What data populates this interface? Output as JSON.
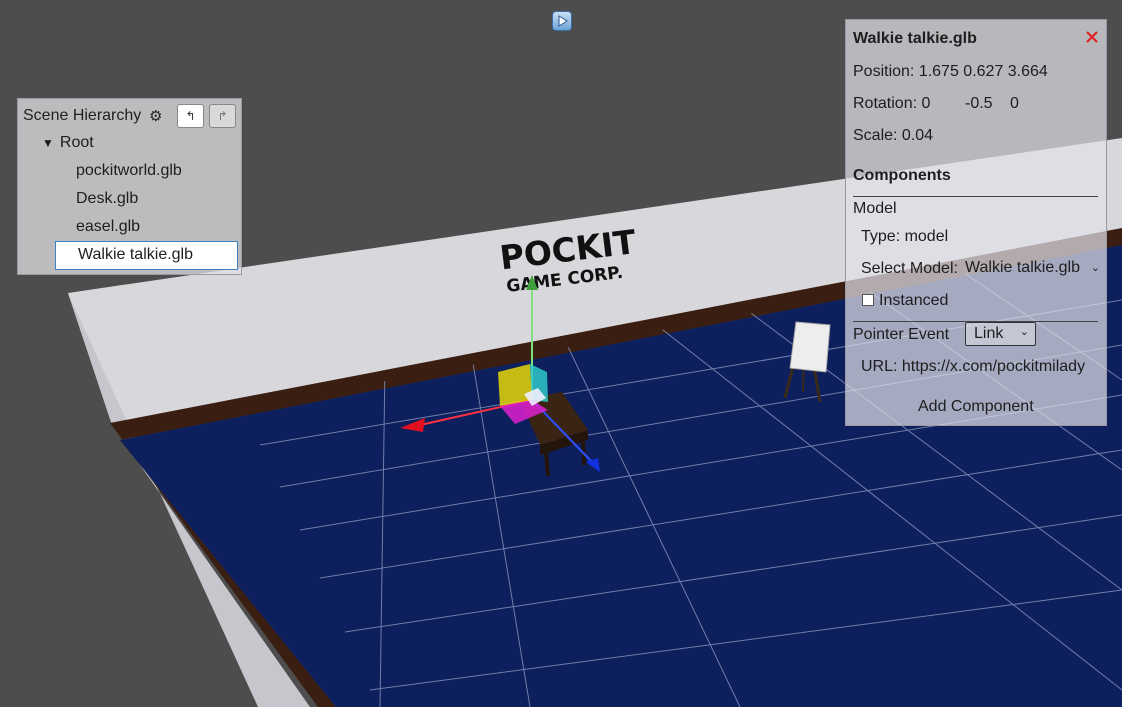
{
  "toolbar": {
    "play_icon": "play-icon"
  },
  "scene_logo": {
    "line1": "POCKIT",
    "line2": "GAME CORP."
  },
  "hierarchy": {
    "title": "Scene Hierarchy",
    "gear_icon": "gear-icon",
    "undo_icon": "undo-icon",
    "redo_icon": "redo-icon",
    "root_label": "Root",
    "items": [
      {
        "label": "pockitworld.glb",
        "selected": false
      },
      {
        "label": "Desk.glb",
        "selected": false
      },
      {
        "label": "easel.glb",
        "selected": false
      },
      {
        "label": "Walkie talkie.glb",
        "selected": true
      }
    ]
  },
  "inspector": {
    "title": "Walkie talkie.glb",
    "close_icon": "close-icon",
    "position": "Position: 1.675 0.627 3.664",
    "rotation_label": "Rotation: 0",
    "rotation_y": "-0.5",
    "rotation_z": "0",
    "scale": "Scale: 0.04",
    "components_heading": "Components",
    "model_heading": "Model",
    "type": "Type: model",
    "select_model_label": "Select Model:",
    "select_model_value": "Walkie talkie.glb",
    "instanced_label": "Instanced",
    "instanced_checked": false,
    "pointer_event_label": "Pointer Event",
    "pointer_event_value": "Link",
    "url": "URL: https://x.com/pockitmilady",
    "add_component": "Add Component"
  },
  "colors": {
    "background": "#4d4d4d",
    "wall": "#d8d8dc",
    "floor": "#0d1f5c",
    "selection_border": "#3b82c4",
    "close_red": "#e02020"
  }
}
